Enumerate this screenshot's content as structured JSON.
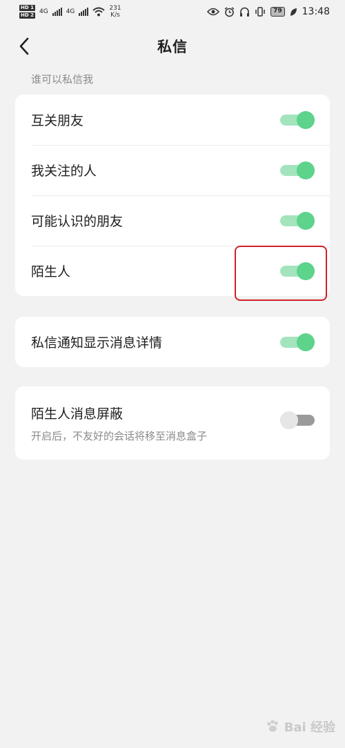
{
  "status_bar": {
    "sim1": "HD",
    "sim1_num": "1",
    "sim2": "HD",
    "sim2_num": "2",
    "net1": "4G",
    "net2": "4G",
    "speed_value": "231",
    "speed_unit": "K/s",
    "battery": "79",
    "time": "13:48"
  },
  "header": {
    "title": "私信"
  },
  "section_label": "谁可以私信我",
  "group1": [
    {
      "label": "互关朋友",
      "on": true
    },
    {
      "label": "我关注的人",
      "on": true
    },
    {
      "label": "可能认识的朋友",
      "on": true
    },
    {
      "label": "陌生人",
      "on": true
    }
  ],
  "group2": {
    "label": "私信通知显示消息详情",
    "on": true
  },
  "group3": {
    "label": "陌生人消息屏蔽",
    "sub": "开启后，不友好的会话将移至消息盒子",
    "on": false
  },
  "watermark": "Bai 经验",
  "colors": {
    "toggle_on_knob": "#5dd38c",
    "toggle_on_track": "#a3e4bd",
    "toggle_off_knob": "#e6e6e6",
    "toggle_off_track": "#9a9a9a",
    "highlight": "#d1202b"
  }
}
